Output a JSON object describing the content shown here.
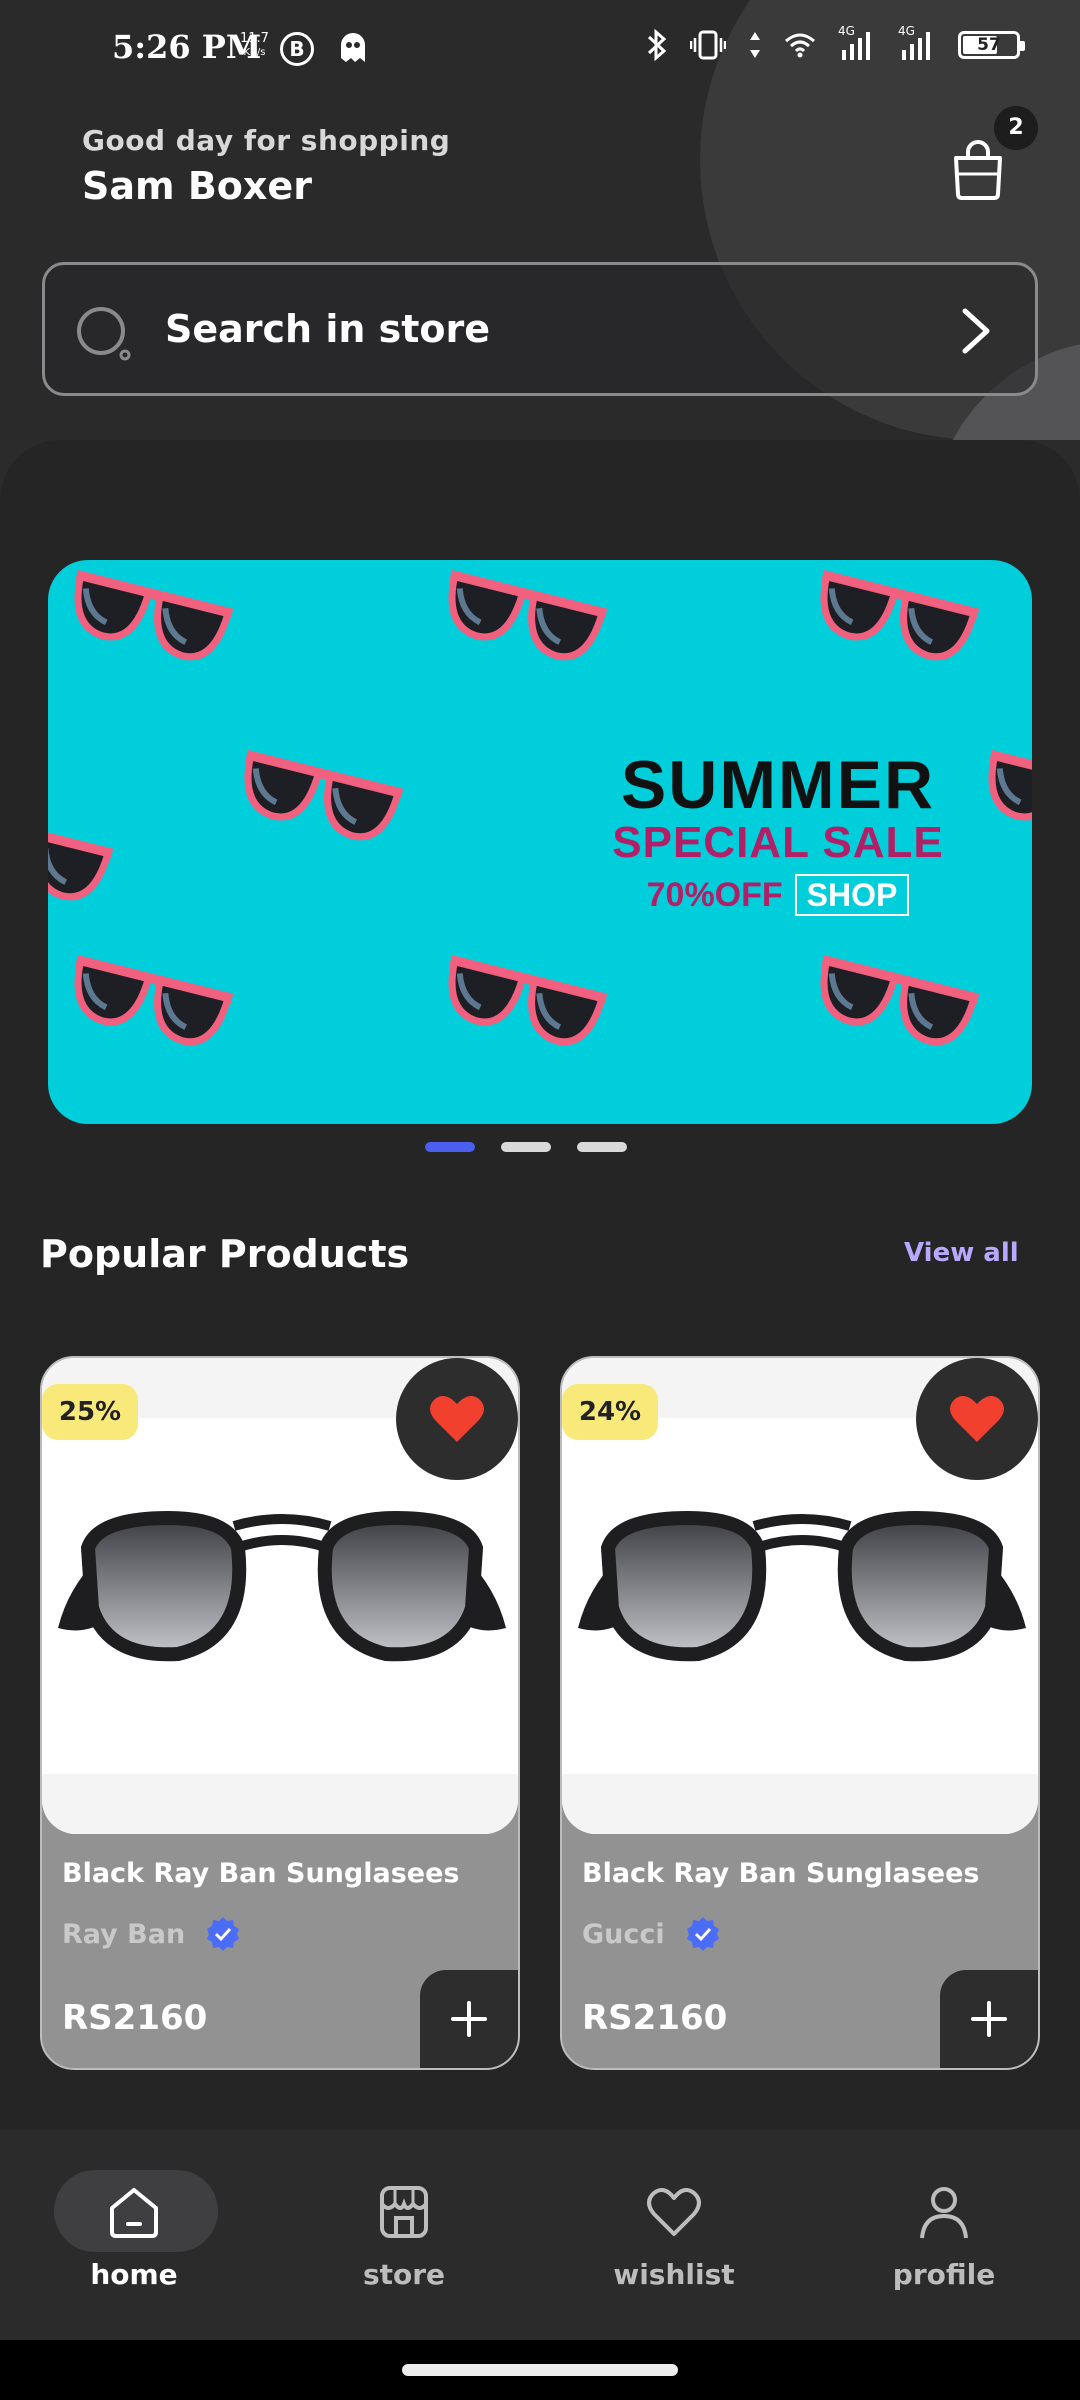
{
  "status_bar": {
    "time": "5:26 PM",
    "speed_value": "11.7",
    "speed_unit": "KB/s",
    "b_icon_letter": "B",
    "network_1": "4G",
    "network_2": "4G",
    "battery": "57"
  },
  "header": {
    "greeting": "Good day for shopping",
    "username": "Sam Boxer",
    "cart_count": "2"
  },
  "search": {
    "placeholder": "Search in store"
  },
  "banner": {
    "line1": "SUMMER",
    "line2": "SPECIAL SALE",
    "discount": "70%OFF",
    "cta": "SHOP",
    "slide_count": 3,
    "active_slide": 0,
    "bg_color": "#00cfdb",
    "accent_color": "#b21f66"
  },
  "popular": {
    "title": "Popular Products",
    "view_all": "View all"
  },
  "products": [
    {
      "discount": "25%",
      "name": "Black Ray Ban Sunglasees",
      "brand": "Ray Ban",
      "price": "RS2160",
      "favorited": true
    },
    {
      "discount": "24%",
      "name": "Black Ray Ban Sunglasees",
      "brand": "Gucci",
      "price": "RS2160",
      "favorited": true
    }
  ],
  "bottom_nav": {
    "items": [
      {
        "label": "home",
        "icon": "home-icon",
        "active": true
      },
      {
        "label": "store",
        "icon": "store-icon",
        "active": false
      },
      {
        "label": "wishlist",
        "icon": "heart-outline-icon",
        "active": false
      },
      {
        "label": "profile",
        "icon": "user-icon",
        "active": false
      }
    ]
  },
  "colors": {
    "background": "#2b2b2c",
    "discount_badge": "#f9e97a",
    "favorite_heart": "#f2402f",
    "verified_badge": "#4a6cf7",
    "view_all": "#b9a8ff",
    "slider_active": "#4a5ff0"
  }
}
